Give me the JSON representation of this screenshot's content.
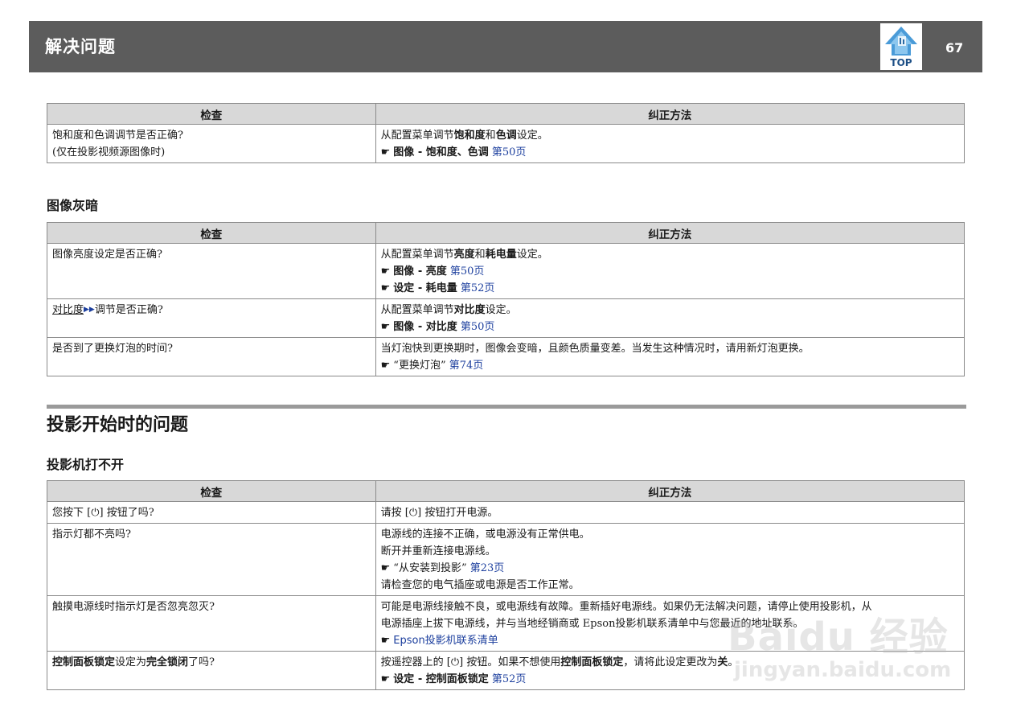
{
  "header": {
    "title": "解决问题",
    "top_label": "TOP",
    "page_number": "67"
  },
  "columns": {
    "check": "检查",
    "remedy": "纠正方法"
  },
  "table1": {
    "row1": {
      "check_line1": "饱和度和色调调节是否正确?",
      "check_line2": "(仅在投影视频源图像时)",
      "remedy_pre": "从配置菜单调节",
      "remedy_b1": "饱和度",
      "remedy_mid": "和",
      "remedy_b2": "色调",
      "remedy_post": "设定。",
      "ref_text": "图像 - 饱和度、色调",
      "ref_link": "第50页"
    }
  },
  "section_dark": {
    "title": "图像灰暗"
  },
  "table2": {
    "row1": {
      "check": "图像亮度设定是否正确?",
      "remedy_pre": "从配置菜单调节",
      "remedy_b1": "亮度",
      "remedy_mid": "和",
      "remedy_b2": "耗电量",
      "remedy_post": "设定。",
      "ref1_text": "图像 - 亮度",
      "ref1_link": "第50页",
      "ref2_text": "设定 - 耗电量",
      "ref2_link": "第52页"
    },
    "row2": {
      "check_term": "对比度",
      "check_post": "调节是否正确?",
      "remedy_pre": "从配置菜单调节",
      "remedy_b1": "对比度",
      "remedy_post": "设定。",
      "ref_text": "图像 - 对比度",
      "ref_link": "第50页"
    },
    "row3": {
      "check": "是否到了更换灯泡的时间?",
      "remedy": "当灯泡快到更换期时，图像会变暗，且颜色质量变差。当发生这种情况时，请用新灯泡更换。",
      "ref_text": "“更换灯泡”",
      "ref_link": "第74页"
    }
  },
  "section_start": {
    "title": "投影开始时的问题"
  },
  "section_power": {
    "title": "投影机打不开"
  },
  "table3": {
    "row1": {
      "check": "您按下 [⏻] 按钮了吗?",
      "remedy": "请按 [⏻] 按钮打开电源。"
    },
    "row2": {
      "check": "指示灯都不亮吗?",
      "remedy_line1": "电源线的连接不正确，或电源没有正常供电。",
      "remedy_line2": "断开并重新连接电源线。",
      "ref_text": "“从安装到投影”",
      "ref_link": "第23页",
      "remedy_line3": "请检查您的电气插座或电源是否工作正常。"
    },
    "row3": {
      "check": "触摸电源线时指示灯是否忽亮忽灭?",
      "remedy_line1": "可能是电源线接触不良，或电源线有故障。重新插好电源线。如果仍无法解决问题，请停止使用投影机，从",
      "remedy_line2": "电源插座上拔下电源线，并与当地经销商或 Epson投影机联系清单中与您最近的地址联系。",
      "ref_link": "Epson投影机联系清单"
    },
    "row4": {
      "check_b1": "控制面板锁定",
      "check_mid": "设定为",
      "check_b2": "完全锁闭",
      "check_post": "了吗?",
      "remedy_pre": "按遥控器上的 [⏻] 按钮。如果不想使用",
      "remedy_b1": "控制面板锁定",
      "remedy_mid": "，请将此设定更改为",
      "remedy_b2": "关",
      "remedy_post": "。",
      "ref_text": "设定 - 控制面板锁定",
      "ref_link": "第52页"
    }
  },
  "watermark": {
    "brand": "Baidu 经验",
    "url": "jingyan.baidu.com"
  },
  "icons": {
    "pointer": "hand-pointer-icon",
    "top": "top-navigation-icon",
    "glossary": "glossary-arrow-icon"
  },
  "colors": {
    "header_bg": "#5c5c5c",
    "link": "#1c3f9e",
    "table_header_bg": "#d8d8d8"
  }
}
